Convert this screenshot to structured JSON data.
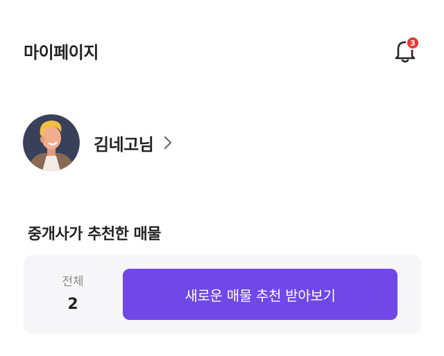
{
  "header": {
    "title": "마이페이지",
    "notification_icon": "bell-icon",
    "notification_count": "3"
  },
  "profile": {
    "name": "김네고님",
    "avatar_icon": "user-avatar",
    "chevron_icon": "chevron-right-icon"
  },
  "section": {
    "title": "중개사가 추천한 매물",
    "total_label": "전체",
    "total_value": "2",
    "cta_label": "새로운 매물 추천 받아보기"
  },
  "colors": {
    "accent": "#7048e8",
    "badge": "#e53935",
    "card_bg": "#f6f6f8"
  }
}
